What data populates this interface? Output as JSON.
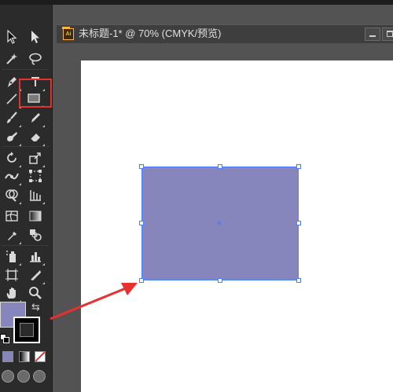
{
  "document": {
    "title": "未标题-1* @ 70% (CMYK/预览)",
    "file_icon_label": "Ai"
  },
  "colors": {
    "fill": "#8686bd",
    "stroke": "#000000",
    "selection": "#4c7cff",
    "highlight": "#e8302f"
  },
  "tools": [
    {
      "name": "selection-tool-icon"
    },
    {
      "name": "direct-selection-tool-icon"
    },
    {
      "name": "magic-wand-tool-icon"
    },
    {
      "name": "lasso-tool-icon"
    },
    {
      "name": "pen-tool-icon"
    },
    {
      "name": "type-tool-icon"
    },
    {
      "name": "line-segment-tool-icon"
    },
    {
      "name": "rectangle-tool-icon",
      "selected": true
    },
    {
      "name": "paintbrush-tool-icon"
    },
    {
      "name": "pencil-tool-icon"
    },
    {
      "name": "blob-brush-tool-icon"
    },
    {
      "name": "eraser-tool-icon"
    },
    {
      "name": "rotate-tool-icon"
    },
    {
      "name": "scale-tool-icon"
    },
    {
      "name": "width-tool-icon"
    },
    {
      "name": "free-transform-tool-icon"
    },
    {
      "name": "shape-builder-tool-icon"
    },
    {
      "name": "perspective-grid-tool-icon"
    },
    {
      "name": "mesh-tool-icon"
    },
    {
      "name": "gradient-tool-icon"
    },
    {
      "name": "eyedropper-tool-icon"
    },
    {
      "name": "blend-tool-icon"
    },
    {
      "name": "symbol-sprayer-tool-icon"
    },
    {
      "name": "column-graph-tool-icon"
    },
    {
      "name": "artboard-tool-icon"
    },
    {
      "name": "slice-tool-icon"
    },
    {
      "name": "hand-tool-icon"
    },
    {
      "name": "zoom-tool-icon"
    }
  ]
}
